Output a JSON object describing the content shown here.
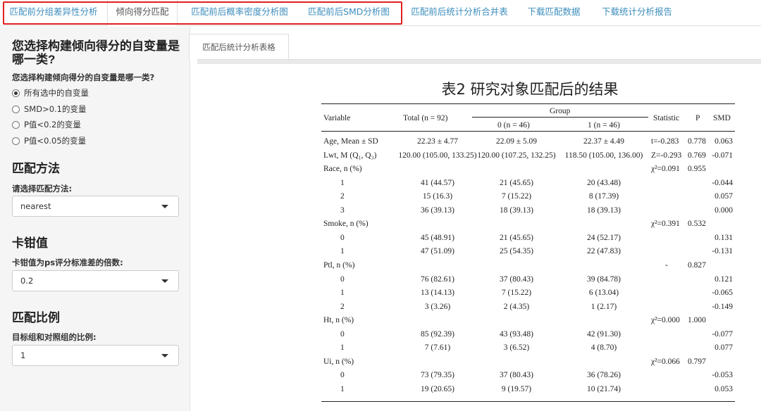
{
  "nav": {
    "tabs": [
      {
        "label": "匹配前分组差异性分析",
        "active": false
      },
      {
        "label": "倾向得分匹配",
        "active": true
      },
      {
        "label": "匹配前后概率密度分析图",
        "active": false
      },
      {
        "label": "匹配前后SMD分析图",
        "active": false
      },
      {
        "label": "匹配前后统计分析合并表",
        "active": false
      },
      {
        "label": "下载匹配数据",
        "active": false
      },
      {
        "label": "下载统计分析报告",
        "active": false
      }
    ]
  },
  "sidebar": {
    "var_heading": "您选择构建倾向得分的自变量是哪一类?",
    "var_label": "您选择构建倾向得分的自变量是哪一类?",
    "radios": [
      {
        "label": "所有选中的自变量",
        "checked": true
      },
      {
        "label": "SMD>0.1的变量",
        "checked": false
      },
      {
        "label": "P值<0.2的变量",
        "checked": false
      },
      {
        "label": "P值<0.05的变量",
        "checked": false
      }
    ],
    "method_heading": "匹配方法",
    "method_label": "请选择匹配方法:",
    "method_value": "nearest",
    "caliper_heading": "卡钳值",
    "caliper_label": "卡钳值为ps评分标准差的倍数:",
    "caliper_value": "0.2",
    "ratio_heading": "匹配比例",
    "ratio_label": "目标组和对照组的比例:",
    "ratio_value": "1"
  },
  "main": {
    "subtab": "匹配后统计分析表格",
    "title": "表2 研究对象匹配后的结果"
  },
  "table": {
    "headers": {
      "variable": "Variable",
      "total": "Total (n = 92)",
      "group": "Group",
      "g0": "0 (n = 46)",
      "g1": "1 (n = 46)",
      "statistic": "Statistic",
      "p": "P",
      "smd": "SMD"
    },
    "rows": [
      {
        "var": "Age, Mean ± SD",
        "indent": false,
        "total": "22.23 ± 4.77",
        "g0": "22.09 ± 5.09",
        "g1": "22.37 ± 4.49",
        "stat": "t=-0.283",
        "p": "0.778",
        "smd": "0.063"
      },
      {
        "var": "Lwt, M (Q₁, Q₃)",
        "indent": false,
        "total": "120.00 (105.00, 133.25)",
        "g0": "120.00 (107.25, 132.25)",
        "g1": "118.50 (105.00, 136.00)",
        "stat": "Z=-0.293",
        "p": "0.769",
        "smd": "-0.071"
      },
      {
        "var": "Race, n (%)",
        "indent": false,
        "total": "",
        "g0": "",
        "g1": "",
        "stat": "χ²=0.091",
        "p": "0.955",
        "smd": ""
      },
      {
        "var": "1",
        "indent": true,
        "total": "41 (44.57)",
        "g0": "21 (45.65)",
        "g1": "20 (43.48)",
        "stat": "",
        "p": "",
        "smd": "-0.044"
      },
      {
        "var": "2",
        "indent": true,
        "total": "15 (16.3)",
        "g0": "7 (15.22)",
        "g1": "8 (17.39)",
        "stat": "",
        "p": "",
        "smd": "0.057"
      },
      {
        "var": "3",
        "indent": true,
        "total": "36 (39.13)",
        "g0": "18 (39.13)",
        "g1": "18 (39.13)",
        "stat": "",
        "p": "",
        "smd": "0.000"
      },
      {
        "var": "Smoke, n (%)",
        "indent": false,
        "total": "",
        "g0": "",
        "g1": "",
        "stat": "χ²=0.391",
        "p": "0.532",
        "smd": ""
      },
      {
        "var": "0",
        "indent": true,
        "total": "45 (48.91)",
        "g0": "21 (45.65)",
        "g1": "24 (52.17)",
        "stat": "",
        "p": "",
        "smd": "0.131"
      },
      {
        "var": "1",
        "indent": true,
        "total": "47 (51.09)",
        "g0": "25 (54.35)",
        "g1": "22 (47.83)",
        "stat": "",
        "p": "",
        "smd": "-0.131"
      },
      {
        "var": "Ptl, n (%)",
        "indent": false,
        "total": "",
        "g0": "",
        "g1": "",
        "stat": "-",
        "p": "0.827",
        "smd": ""
      },
      {
        "var": "0",
        "indent": true,
        "total": "76 (82.61)",
        "g0": "37 (80.43)",
        "g1": "39 (84.78)",
        "stat": "",
        "p": "",
        "smd": "0.121"
      },
      {
        "var": "1",
        "indent": true,
        "total": "13 (14.13)",
        "g0": "7 (15.22)",
        "g1": "6 (13.04)",
        "stat": "",
        "p": "",
        "smd": "-0.065"
      },
      {
        "var": "2",
        "indent": true,
        "total": "3 (3.26)",
        "g0": "2 (4.35)",
        "g1": "1 (2.17)",
        "stat": "",
        "p": "",
        "smd": "-0.149"
      },
      {
        "var": "Ht, n (%)",
        "indent": false,
        "total": "",
        "g0": "",
        "g1": "",
        "stat": "χ²=0.000",
        "p": "1.000",
        "smd": ""
      },
      {
        "var": "0",
        "indent": true,
        "total": "85 (92.39)",
        "g0": "43 (93.48)",
        "g1": "42 (91.30)",
        "stat": "",
        "p": "",
        "smd": "-0.077"
      },
      {
        "var": "1",
        "indent": true,
        "total": "7 (7.61)",
        "g0": "3 (6.52)",
        "g1": "4 (8.70)",
        "stat": "",
        "p": "",
        "smd": "0.077"
      },
      {
        "var": "Ui, n (%)",
        "indent": false,
        "total": "",
        "g0": "",
        "g1": "",
        "stat": "χ²=0.066",
        "p": "0.797",
        "smd": ""
      },
      {
        "var": "0",
        "indent": true,
        "total": "73 (79.35)",
        "g0": "37 (80.43)",
        "g1": "36 (78.26)",
        "stat": "",
        "p": "",
        "smd": "-0.053"
      },
      {
        "var": "1",
        "indent": true,
        "total": "19 (20.65)",
        "g0": "9 (19.57)",
        "g1": "10 (21.74)",
        "stat": "",
        "p": "",
        "smd": "0.053"
      }
    ]
  }
}
